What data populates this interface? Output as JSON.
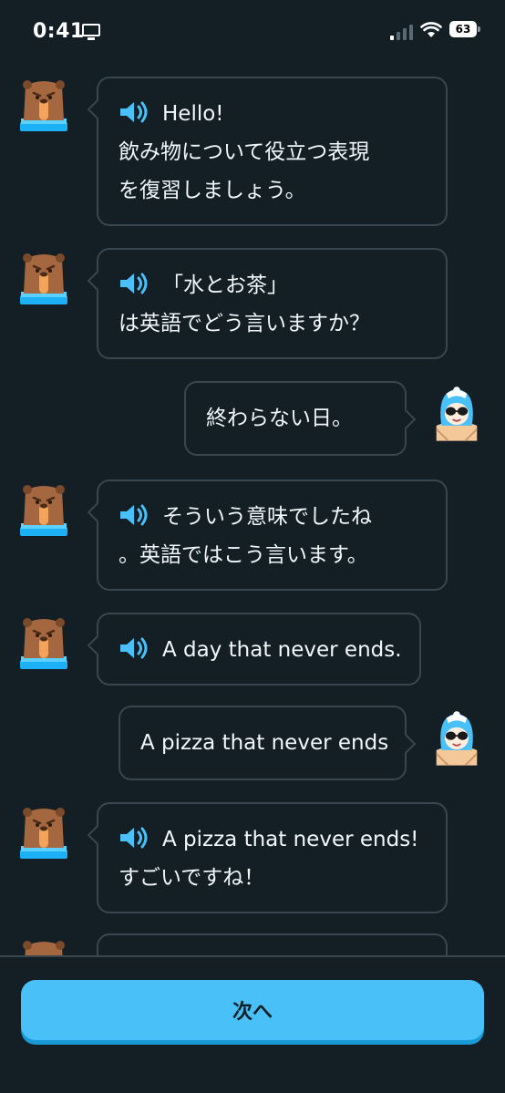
{
  "status_bar": {
    "time": "0:41",
    "battery": "63"
  },
  "messages": [
    {
      "speaker": "bear",
      "lines": [
        "Hello!",
        "飲み物について役立つ表現",
        "を復習しましょう。"
      ],
      "audio": true
    },
    {
      "speaker": "bear",
      "lines": [
        "「水とお茶」",
        "は英語でどう言いますか？"
      ],
      "audio": true
    },
    {
      "speaker": "user",
      "lines": [
        "終わらない日。"
      ],
      "audio": false
    },
    {
      "speaker": "bear",
      "lines": [
        "そういう意味でしたね",
        "。英語ではこう言います。"
      ],
      "audio": true
    },
    {
      "speaker": "bear",
      "lines": [
        "A day that never ends."
      ],
      "audio": true
    },
    {
      "speaker": "user",
      "lines": [
        "A pizza that never ends"
      ],
      "audio": false
    },
    {
      "speaker": "bear",
      "lines": [
        "A pizza that never ends!",
        "すごいですね！"
      ],
      "audio": true
    }
  ],
  "footer": {
    "next_label": "次へ"
  },
  "colors": {
    "background": "#131f24",
    "bubble_border": "#37464f",
    "accent": "#49c0f8",
    "speaker_icon": "#49c0f8"
  }
}
